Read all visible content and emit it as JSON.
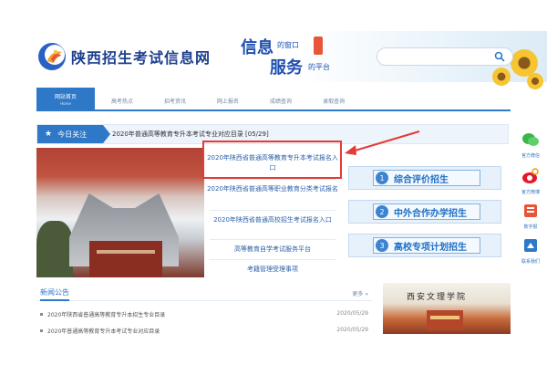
{
  "header": {
    "site_title": "陕西招生考试信息网",
    "slogan_line1": "信息",
    "slogan_line1_small": "的窗口",
    "slogan_line2": "服务",
    "slogan_line2_small": "的平台",
    "search": {
      "value": "",
      "placeholder": ""
    }
  },
  "nav": {
    "items": [
      {
        "label": "网站首页",
        "sub": "Home",
        "active": true
      },
      {
        "label": "高考热点"
      },
      {
        "label": "招考资讯"
      },
      {
        "label": "网上报名"
      },
      {
        "label": "成绩查询"
      },
      {
        "label": "录取查询"
      }
    ]
  },
  "ticker": {
    "tag": "今日关注",
    "text": "2020年普通高等教育专升本考试专业对应目录  [05/29]"
  },
  "links": {
    "items": [
      "2020年陕西省普通高等教育专升本考试报名入口",
      "2020年陕西省普通高等职业教育分类考试报名",
      "2020年陕西省普通高校招生考试报名入口",
      "高等教育自学考试服务平台",
      "考籍管理受理事项"
    ]
  },
  "right_buttons": [
    {
      "num": "1",
      "label": "综合评价招生"
    },
    {
      "num": "2",
      "label": "中外合作办学招生"
    },
    {
      "num": "3",
      "label": "高校专项计划招生"
    }
  ],
  "social": [
    {
      "icon": "wechat-icon",
      "label": "官方微信"
    },
    {
      "icon": "weibo-icon",
      "label": "官方微博"
    },
    {
      "icon": "digital-newspaper-icon",
      "label": "数字报"
    },
    {
      "icon": "contact-icon",
      "label": "联系我们"
    }
  ],
  "news": {
    "title": "新闻公告",
    "more": "更多 »",
    "rows": [
      {
        "title": "2020年陕西省普通高等教育专升本招生专业目录",
        "date": "2020/05/29"
      },
      {
        "title": "2020年普通高等教育专升本考试专业对应目录",
        "date": "2020/05/29"
      }
    ]
  },
  "photo2": {
    "text": "西安文理学院"
  },
  "colors": {
    "primary": "#2e78c8",
    "highlight_border": "#e43b36",
    "title_navy": "#1e3f8f"
  }
}
